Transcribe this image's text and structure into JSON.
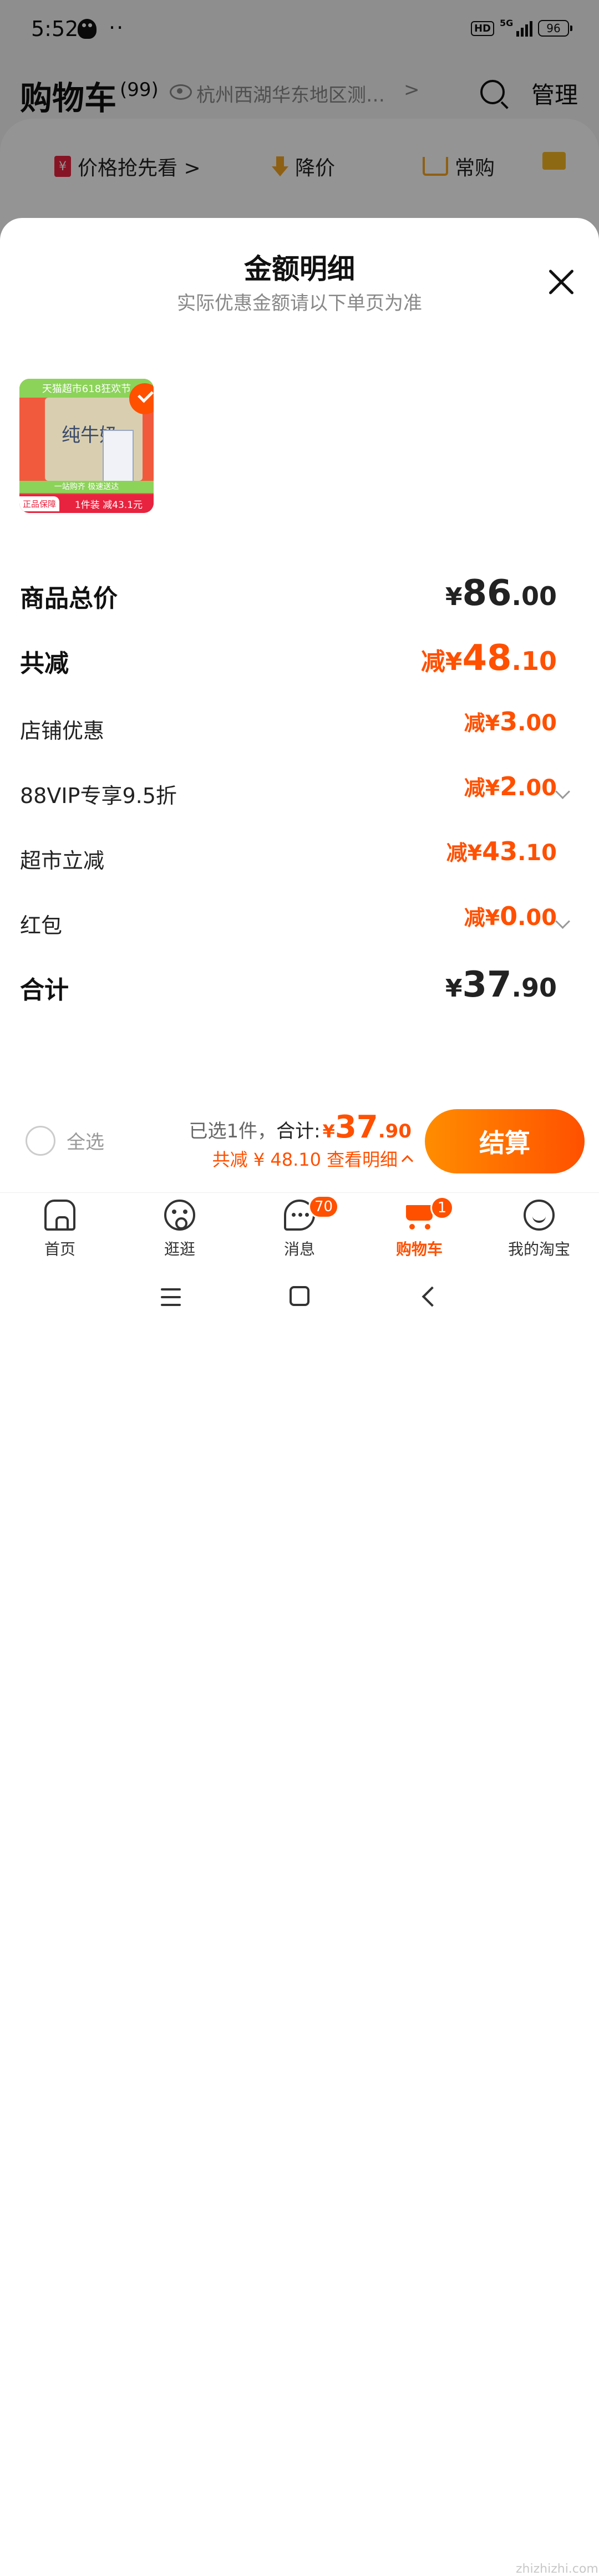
{
  "status_bar": {
    "time": "5:52",
    "dots": "··",
    "hd": "HD",
    "network": "5G",
    "battery": "96"
  },
  "cart_header": {
    "title": "购物车",
    "count": "(99)",
    "address": "杭州西湖华东地区测…",
    "address_arrow": ">",
    "manage": "管理"
  },
  "bg_tabs": [
    {
      "label": "价格抢先看 >"
    },
    {
      "label": "降价"
    },
    {
      "label": "常购"
    }
  ],
  "sheet": {
    "title": "金额明细",
    "subtitle": "实际优惠金额请以下单页为准",
    "product": {
      "top_banner": "天猫超市618狂欢节",
      "box_label": "纯牛奶",
      "strip_text": "一站购齐 极速送达",
      "bottom_text": "1件装 减43.1元",
      "badge": "正品保障"
    },
    "rows": [
      {
        "label": "商品总价",
        "prefix": "¥",
        "int": "86",
        "dec": ".00"
      },
      {
        "label": "共减",
        "prefix": "减¥",
        "int": "48",
        "dec": ".10"
      },
      {
        "label": "店铺优惠",
        "prefix": "减¥",
        "int": "3",
        "dec": ".00"
      },
      {
        "label": "88VIP专享9.5折",
        "prefix": "减¥",
        "int": "2",
        "dec": ".00"
      },
      {
        "label": "超市立减",
        "prefix": "减¥",
        "int": "43",
        "dec": ".10"
      },
      {
        "label": "红包",
        "prefix": "减¥",
        "int": "0",
        "dec": ".00"
      },
      {
        "label": "合计",
        "prefix": "¥",
        "int": "37",
        "dec": ".90"
      }
    ]
  },
  "footer": {
    "select_all": "全选",
    "selected_text": "已选1件，",
    "total_label": "合计:",
    "total_yen": "¥",
    "total_int": "37",
    "total_dec": ".90",
    "saving_text": "共减 ¥ 48.10",
    "detail_link": "查看明细",
    "checkout": "结算"
  },
  "tabbar": [
    {
      "label": "首页"
    },
    {
      "label": "逛逛"
    },
    {
      "label": "消息",
      "badge": "70"
    },
    {
      "label": "购物车",
      "badge": "1"
    },
    {
      "label": "我的淘宝"
    }
  ],
  "watermark": "zhizhizhi.com",
  "colors": {
    "accent": "#ff5000",
    "accent_gradient_start": "#ff8d00",
    "text_dark": "#222222",
    "text_muted": "#888888"
  }
}
